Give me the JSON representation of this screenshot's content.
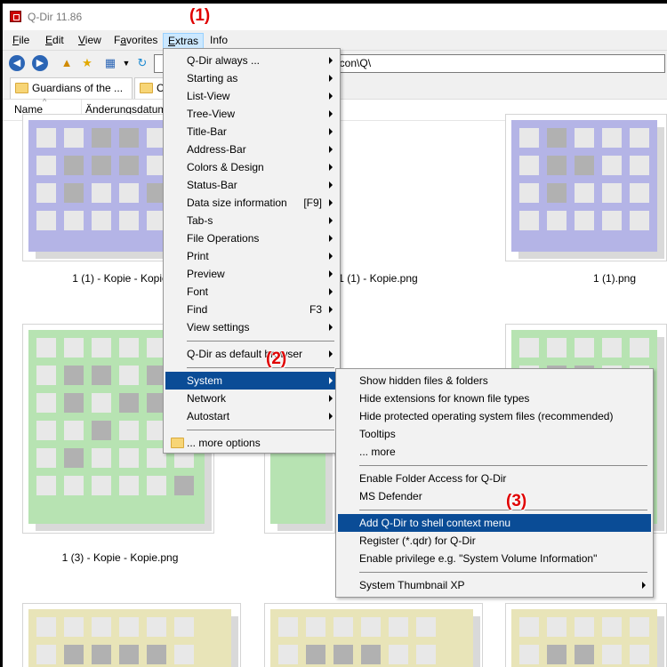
{
  "window": {
    "title": "Q-Dir 11.86"
  },
  "menubar": {
    "items": [
      {
        "label": "File",
        "u": "F"
      },
      {
        "label": "Edit",
        "u": "E"
      },
      {
        "label": "View",
        "u": "V"
      },
      {
        "label": "Favorites",
        "u": "a"
      },
      {
        "label": "Extras",
        "u": "E"
      },
      {
        "label": "Info",
        "u": ""
      }
    ]
  },
  "address": {
    "value": "g\\icon\\Q\\"
  },
  "tabs": [
    {
      "label": "Guardians of the ..."
    },
    {
      "label": "C"
    }
  ],
  "columns": {
    "name": "Name",
    "date": "Änderungsdatum"
  },
  "files": [
    {
      "caption": "1 (1) - Kopie - Kopie"
    },
    {
      "caption": "1 (1) - Kopie.png"
    },
    {
      "caption": "1 (1).png"
    },
    {
      "caption": "1 (3) - Kopie - Kopie.png"
    }
  ],
  "extras_menu": [
    {
      "label": "Q-Dir always ...",
      "arrow": true
    },
    {
      "label": "Starting as",
      "arrow": true
    },
    {
      "label": "List-View",
      "arrow": true
    },
    {
      "label": "Tree-View",
      "arrow": true
    },
    {
      "label": "Title-Bar",
      "arrow": true
    },
    {
      "label": "Address-Bar",
      "arrow": true
    },
    {
      "label": "Colors & Design",
      "arrow": true
    },
    {
      "label": "Status-Bar",
      "arrow": true
    },
    {
      "label": "Data size information",
      "shortcut": "[F9]",
      "arrow": true
    },
    {
      "label": "Tab-s",
      "arrow": true
    },
    {
      "label": "File Operations",
      "arrow": true
    },
    {
      "label": "Print",
      "arrow": true
    },
    {
      "label": "Preview",
      "arrow": true
    },
    {
      "label": "Font",
      "arrow": true
    },
    {
      "label": "Find",
      "shortcut": "F3",
      "arrow": true
    },
    {
      "label": "View settings",
      "arrow": true
    },
    {
      "separator": true
    },
    {
      "label": "Q-Dir as default browser",
      "arrow": true
    },
    {
      "separator": true
    },
    {
      "label": "System",
      "arrow": true,
      "selected": true
    },
    {
      "label": "Network",
      "arrow": true
    },
    {
      "label": "Autostart",
      "arrow": true
    },
    {
      "separator": true
    },
    {
      "label": "... more options",
      "folder": true
    }
  ],
  "system_menu": [
    {
      "label": "Show hidden files & folders"
    },
    {
      "label": "Hide extensions for known file types"
    },
    {
      "label": "Hide protected operating system files (recommended)"
    },
    {
      "label": "Tooltips"
    },
    {
      "label": "... more"
    },
    {
      "separator": true
    },
    {
      "label": "Enable Folder Access for Q-Dir"
    },
    {
      "label": "MS Defender"
    },
    {
      "separator": true
    },
    {
      "label": "Add Q-Dir to shell context menu",
      "selected": true
    },
    {
      "label": "Register (*.qdr) for Q-Dir"
    },
    {
      "label": "Enable privilege e.g. \"System Volume Information\""
    },
    {
      "separator": true
    },
    {
      "label": "System Thumbnail XP",
      "arrow": true
    }
  ],
  "annotations": [
    "(1)",
    "(2)",
    "(3)"
  ],
  "colors": {
    "menu_highlight": "#0a4c96",
    "badge_red": "#e00000",
    "thumb_purple": "#b4b4e6",
    "thumb_green": "#b7e3b2",
    "thumb_tan": "#e8e4b8"
  }
}
